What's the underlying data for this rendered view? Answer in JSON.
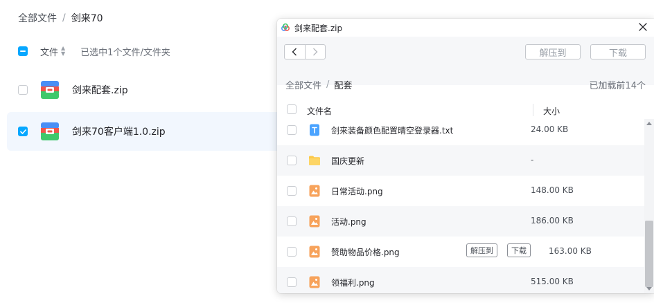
{
  "background": {
    "breadcrumb": {
      "root": "全部文件",
      "separator": "/",
      "current": "剑来70"
    },
    "header": {
      "name_label": "文件",
      "sort_icon": "sort-arrows-icon",
      "selection_text": "已选中1个文件/文件夹"
    },
    "files": [
      {
        "name": "剑来配套.zip",
        "checked": false,
        "icon": "zip-archive-icon"
      },
      {
        "name": "剑来70客户端1.0.zip",
        "checked": true,
        "icon": "zip-archive-icon"
      }
    ]
  },
  "dialog": {
    "title": "剑来配套.zip",
    "nav": {
      "back_icon": "chevron-left-icon",
      "forward_icon": "chevron-right-icon"
    },
    "toolbar": {
      "extract_label": "解压到",
      "download_label": "下载"
    },
    "breadcrumb": {
      "root": "全部文件",
      "separator": "/",
      "current": "配套"
    },
    "loaded_text": "已加载前14个",
    "columns": {
      "name": "文件名",
      "size": "大小"
    },
    "items": [
      {
        "name": "剑来装备颜色配置晴空登录器.txt",
        "size": "24.00 KB",
        "icon": "text-file-icon"
      },
      {
        "name": "国庆更新",
        "size": "-",
        "icon": "folder-icon"
      },
      {
        "name": "日常活动.png",
        "size": "148.00 KB",
        "icon": "image-file-icon"
      },
      {
        "name": "活动.png",
        "size": "186.00 KB",
        "icon": "image-file-icon"
      },
      {
        "name": "赞助物品价格.png",
        "size": "163.00 KB",
        "icon": "image-file-icon",
        "hover": true,
        "row_extract_label": "解压到",
        "row_download_label": "下载"
      },
      {
        "name": "领福利.png",
        "size": "515.00 KB",
        "icon": "image-file-icon"
      }
    ]
  },
  "colors": {
    "accent": "#06a7ff",
    "selected_row": "#f2f7fe",
    "text_primary": "#25262b",
    "text_secondary": "#6b7079",
    "zip_red": "#f0554a",
    "zip_green": "#3fc86b",
    "zip_blue": "#4a8ff5",
    "image_orange": "#f7a35c",
    "folder_yellow": "#fcc94a",
    "text_file_blue": "#4aa3ff"
  }
}
